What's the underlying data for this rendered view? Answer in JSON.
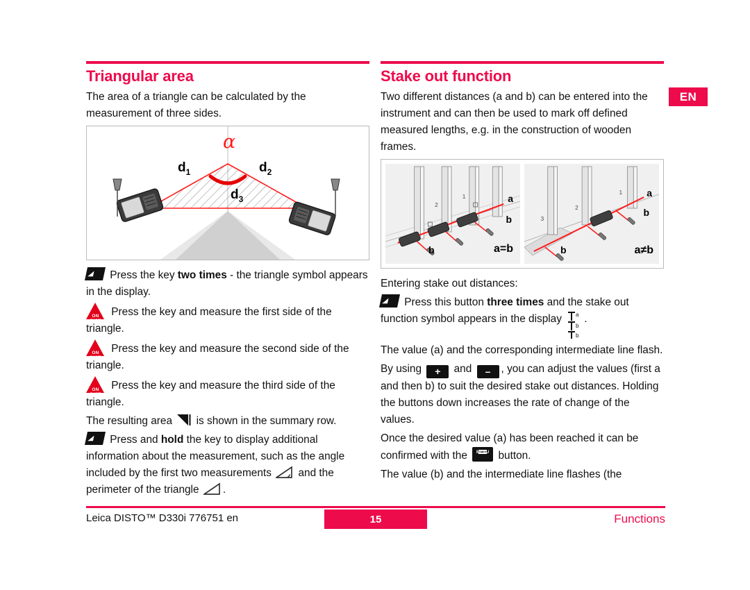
{
  "document": {
    "language_badge": "EN",
    "accent_color": "#ED0B4C",
    "dist_icon_color": "#E3001B"
  },
  "left_column": {
    "title": "Triangular area",
    "intro": "The area of a triangle can be calculated by the measurement of three sides.",
    "figure": {
      "name": "triangle-area-diagram",
      "labels": {
        "angle": "α",
        "side1": "d",
        "side1_sub": "1",
        "side2": "d",
        "side2_sub": "2",
        "side3": "d",
        "side3_sub": "3"
      }
    },
    "steps": [
      {
        "icon": "func-key-icon",
        "text_before": "Press the key ",
        "bold": "two times",
        "text_after": " - the triangle symbol appears in the display."
      },
      {
        "icon": "on-dist-key-icon",
        "text_before": "Press the key and measure the first side of the triangle.",
        "bold": "",
        "text_after": ""
      },
      {
        "icon": "on-dist-key-icon",
        "text_before": "Press the key and measure the second side of the triangle.",
        "bold": "",
        "text_after": ""
      },
      {
        "icon": "on-dist-key-icon",
        "text_before": "Press the key and measure the third side of the triangle.",
        "bold": "",
        "text_after": ""
      }
    ],
    "result_line": {
      "prefix": "The resulting area ",
      "suffix": " is shown in the summary row."
    },
    "hold_paragraph": {
      "prefix": "Press and ",
      "bold": "hold",
      "mid": " the key to display additional information about the measurement, such as the angle included by the first two measurements ",
      "mid2": " and the perimeter of the triangle ",
      "suffix": "."
    }
  },
  "right_column": {
    "title": "Stake out function",
    "intro": "Two different distances (a and b) can be entered into the instrument and can then be used to mark off defined measured lengths, e.g. in the construction of wooden frames.",
    "figure": {
      "name": "stake-out-diagram",
      "left_panel": {
        "label_a": "a",
        "label_b_top": "b",
        "label_b_bottom": "b",
        "equation": "a=b",
        "marker_1": "1",
        "marker_2": "2"
      },
      "right_panel": {
        "label_a": "a",
        "label_b_top": "b",
        "label_b_bottom": "b",
        "equation": "a≠b",
        "marker_1": "1",
        "marker_2": "2",
        "marker_3": "3"
      }
    },
    "entering_heading": "Entering stake out distances:",
    "step_three_times": {
      "prefix": "Press this button ",
      "bold": "three times",
      "mid": " and the stake out function symbol appears in the display ",
      "suffix": "."
    },
    "stakeout_symbol": {
      "a": "a",
      "b1": "b",
      "b2": "b"
    },
    "flash_paragraph": "The value (a) and the corresponding intermediate line flash.",
    "adjust_paragraph": {
      "prefix": "By using ",
      "plus_label": "+",
      "mid": " and ",
      "minus_label": "–",
      "suffix": ", you can adjust the values (first a and then b) to suit the desired stake out distances. Holding the buttons down increases the rate of change of the values."
    },
    "confirm_paragraph": {
      "prefix": "Once the desired value (a) has been reached it can be confirmed with the ",
      "menu_label": "MENU",
      "suffix": " button."
    },
    "final_paragraph": "The value (b) and the intermediate line flashes (the"
  },
  "footer": {
    "left": "Leica DISTO™ D330i 776751 en",
    "page_number": "15",
    "right": "Functions"
  }
}
